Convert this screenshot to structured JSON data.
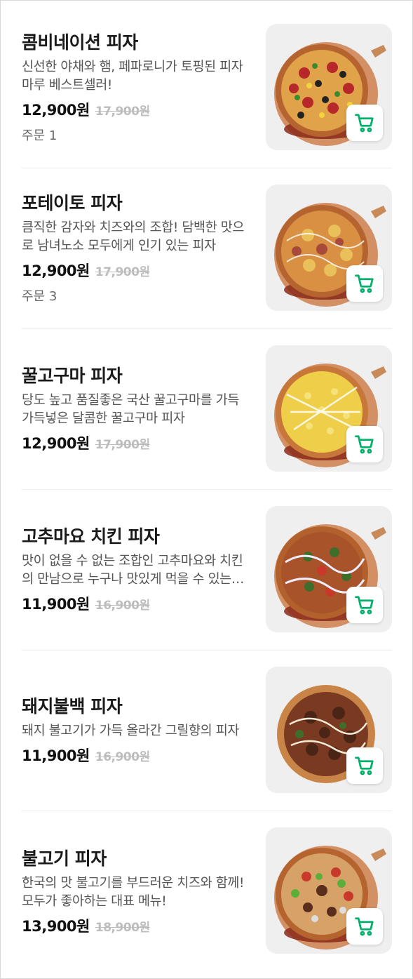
{
  "accent_color": "#00b06b",
  "cart_icon": "shopping-cart-icon",
  "menu": [
    {
      "name": "콤비네이션 피자",
      "description": "신선한 야채와 햄, 페파로니가 토핑된 피자마루 베스트셀러!",
      "price": "12,900원",
      "original_price": "17,900원",
      "orders": "주문 1",
      "image": "combination-pizza-image"
    },
    {
      "name": "포테이토 피자",
      "description": "큼직한 감자와 치즈와의 조합! 담백한 맛으로 남녀노소 모두에게 인기 있는 피자",
      "price": "12,900원",
      "original_price": "17,900원",
      "orders": "주문 3",
      "image": "potato-pizza-image"
    },
    {
      "name": "꿀고구마 피자",
      "description": "당도 높고 품질좋은 국산 꿀고구마를 가득가득넣은 달콤한 꿀고구마 피자",
      "price": "12,900원",
      "original_price": "17,900원",
      "image": "sweet-potato-pizza-image"
    },
    {
      "name": "고추마요 치킨 피자",
      "description": "맛이 없을 수 없는 조합인 고추마요와 치킨의 만남으로 누구나 맛있게 먹을 수 있는 피자",
      "price": "11,900원",
      "original_price": "16,900원",
      "image": "chili-mayo-chicken-pizza-image"
    },
    {
      "name": "돼지불백 피자",
      "description": "돼지 불고기가 가득 올라간 그릴향의 피자",
      "price": "11,900원",
      "original_price": "16,900원",
      "image": "pork-bulbaek-pizza-image"
    },
    {
      "name": "불고기 피자",
      "description": "한국의 맛 불고기를 부드러운 치즈와 함께! 모두가 좋아하는 대표 메뉴!",
      "price": "13,900원",
      "original_price": "18,900원",
      "image": "bulgogi-pizza-image"
    }
  ]
}
